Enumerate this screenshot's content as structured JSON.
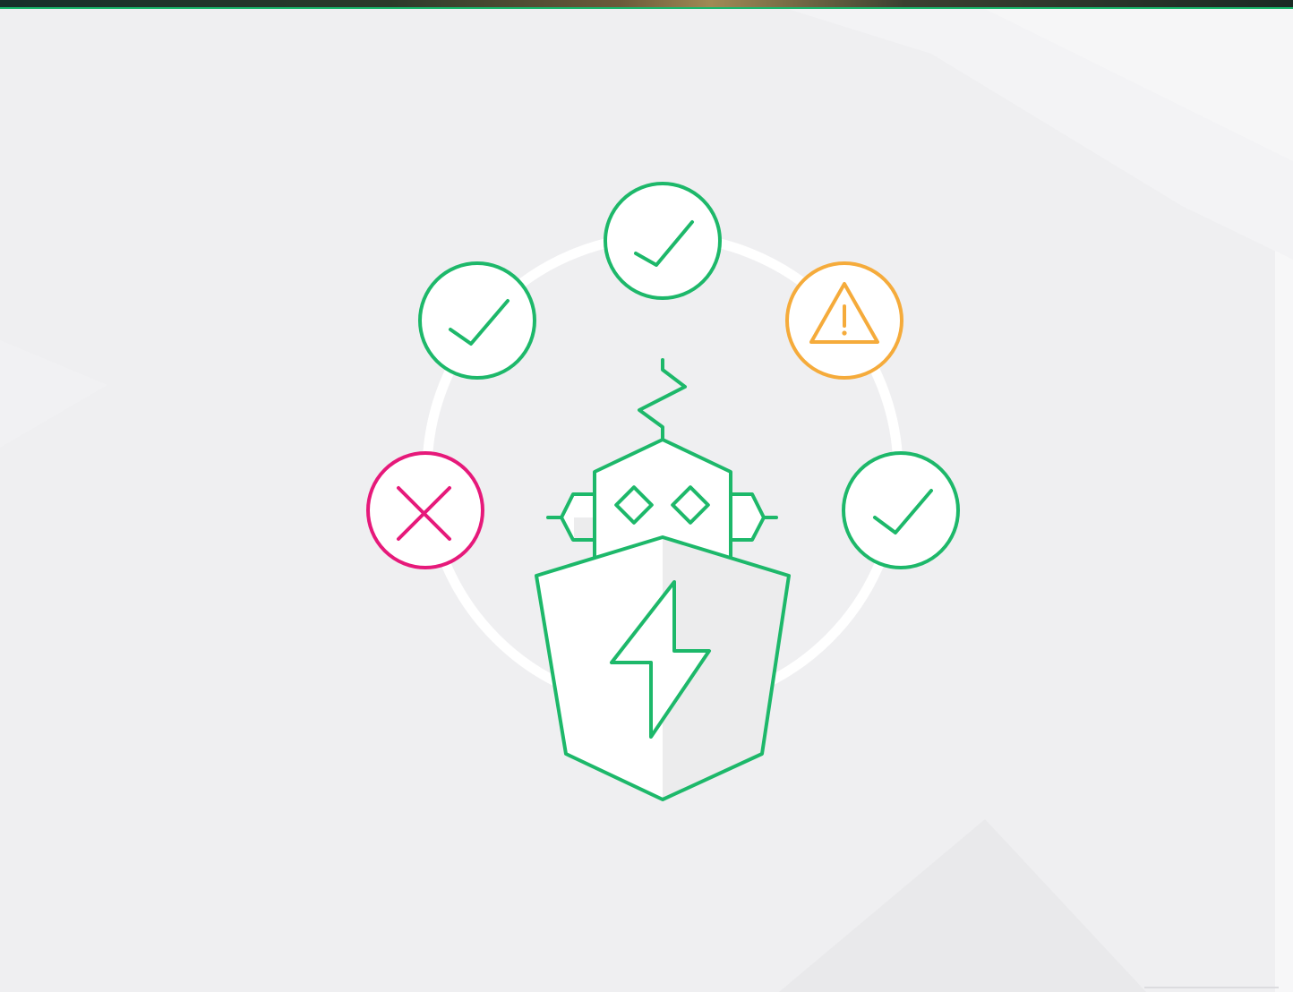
{
  "illustration": {
    "colors": {
      "background": "#efeff1",
      "ring": "#ffffff",
      "success": "#1db86a",
      "warning": "#f5ab3b",
      "error": "#e6197a",
      "fill": "#ffffff",
      "shade": "#ececed"
    },
    "status_nodes": [
      {
        "icon": "check-icon",
        "status": "success"
      },
      {
        "icon": "check-icon",
        "status": "success"
      },
      {
        "icon": "warning-icon",
        "status": "warning"
      },
      {
        "icon": "cross-icon",
        "status": "error"
      },
      {
        "icon": "check-icon",
        "status": "success"
      }
    ],
    "center": {
      "icon": "robot-shield-lightning-icon"
    }
  }
}
